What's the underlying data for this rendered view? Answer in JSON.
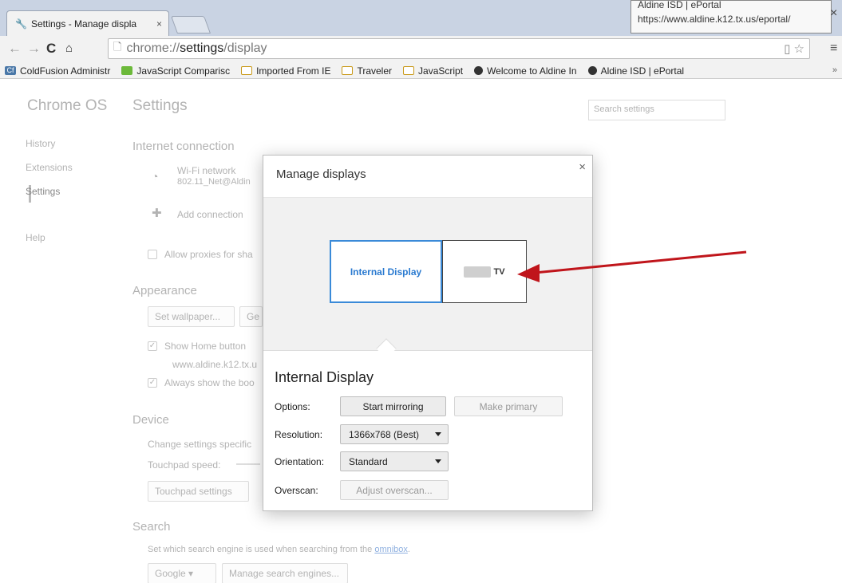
{
  "browser": {
    "tab": {
      "title": "Settings - Manage displa",
      "close": "×"
    },
    "tooltip": {
      "line1": "Aldine ISD | ePortal",
      "line2": "https://www.aldine.k12.tx.us/eportal/"
    },
    "window_close": "×",
    "omnibox": {
      "scheme": "chrome://",
      "host": "settings",
      "path": "/display"
    },
    "bookmarks": [
      {
        "label": "ColdFusion Administr",
        "icon": "coldfusion-icon"
      },
      {
        "label": "JavaScript Comparisc",
        "icon": "javascript-icon"
      },
      {
        "label": "Imported From IE",
        "icon": "folder-icon"
      },
      {
        "label": "Traveler",
        "icon": "folder-icon"
      },
      {
        "label": "JavaScript",
        "icon": "folder-icon"
      },
      {
        "label": "Welcome to Aldine In",
        "icon": "globe-icon"
      },
      {
        "label": "Aldine ISD | ePortal",
        "icon": "globe-icon"
      }
    ],
    "bookmarks_more": "»"
  },
  "settings": {
    "brand": "Chrome OS",
    "title": "Settings",
    "search_placeholder": "Search settings",
    "nav": [
      "History",
      "Extensions",
      "Settings",
      "Help"
    ],
    "internet": {
      "heading": "Internet connection",
      "wifi_name": "Wi-Fi network",
      "wifi_ssid": "802.11_Net@Aldin",
      "add_connection": "Add connection",
      "allow_proxies": "Allow proxies for sha"
    },
    "appearance": {
      "heading": "Appearance",
      "set_wallpaper": "Set wallpaper...",
      "get_themes": "Ge",
      "show_home": "Show Home button",
      "home_url": "www.aldine.k12.tx.u",
      "always_bookmarks": "Always show the boo"
    },
    "device": {
      "heading": "Device",
      "desc": "Change settings specific",
      "touchpad_speed": "Touchpad speed:",
      "touchpad_settings": "Touchpad settings"
    },
    "search": {
      "heading": "Search",
      "desc": "Set which search engine is used when searching from the ",
      "link": "omnibox",
      "desc_end": ".",
      "engine": "Google",
      "manage": "Manage search engines..."
    }
  },
  "dialog": {
    "title": "Manage displays",
    "close": "×",
    "displays": {
      "internal": "Internal Display",
      "tv": "TV"
    },
    "selected_display": "Internal Display",
    "options_label": "Options:",
    "start_mirroring": "Start mirroring",
    "make_primary": "Make primary",
    "resolution_label": "Resolution:",
    "resolution_value": "1366x768 (Best)",
    "orientation_label": "Orientation:",
    "orientation_value": "Standard",
    "overscan_label": "Overscan:",
    "adjust_overscan": "Adjust overscan..."
  },
  "colors": {
    "selected_display_border": "#3a8ad8",
    "annotation_arrow": "#c0151b"
  }
}
